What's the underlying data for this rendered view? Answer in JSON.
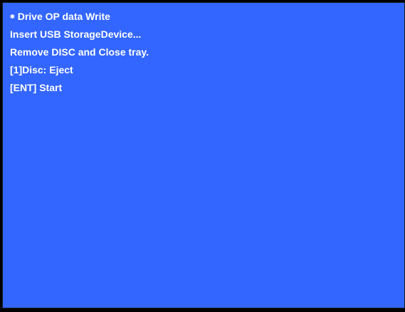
{
  "screen": {
    "background_color": "#3366ff",
    "frame_color": "#000000",
    "text_color": "#ffffff",
    "bullet_symbol": "✱",
    "lines": [
      "Drive OP data Write",
      "Insert USB StorageDevice...",
      "Remove DISC and Close tray.",
      "[1]Disc: Eject",
      "[ENT] Start"
    ]
  }
}
